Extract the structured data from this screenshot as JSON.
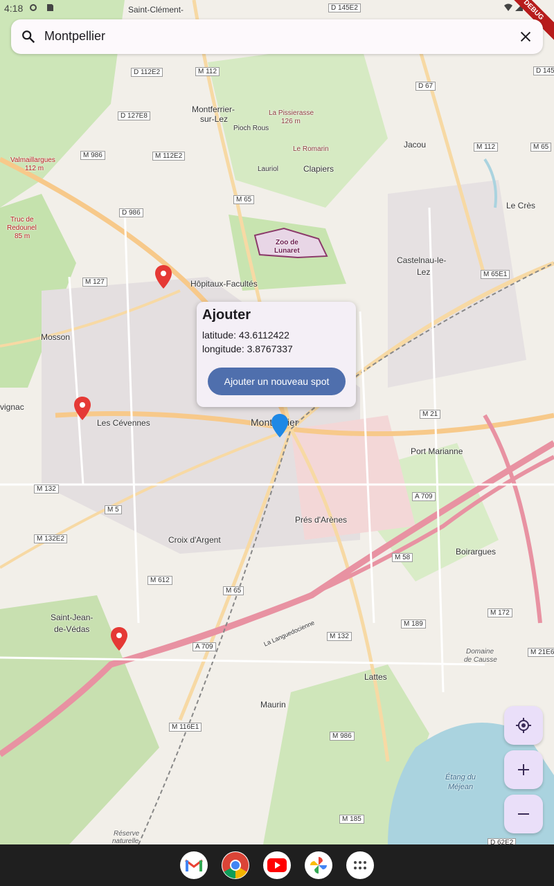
{
  "status": {
    "time": "4:18",
    "debug_label": "DEBUG"
  },
  "search": {
    "query": "Montpellier"
  },
  "popup": {
    "title": "Ajouter",
    "latitude": "latitude: 43.6112422",
    "longitude": "longitude: 3.8767337",
    "button": "Ajouter un nouveau spot"
  },
  "map": {
    "labels": {
      "saint_clement": "Saint-Clément-",
      "montferrier": "Montferrier-",
      "sur_lez": "sur-Lez",
      "pioch_rous": "Pioch Rous",
      "la_pissierasse": "La Pissierasse",
      "elev_126": "126 m",
      "le_romarin": "Le Romarin",
      "jacou": "Jacou",
      "lauriol": "Lauriol",
      "clapiers": "Clapiers",
      "valmaillargues": "Valmaillargues",
      "elev_112": "112 m",
      "truc_de": "Truc de",
      "redounel": "Redounel",
      "elev_85": "85 m",
      "zoo": "Zoo de",
      "lunaret": "Lunaret",
      "le_cres": "Le Crès",
      "castelnau": "Castelnau-le-",
      "lez": "Lez",
      "hopitaux": "Hôpitaux-Facultés",
      "mosson": "Mosson",
      "vignac": "vignac",
      "les_cevennes": "Les Cévennes",
      "montpellier": "Montpellier",
      "port_marianne": "Port Marianne",
      "pres_darenes": "Prés d'Arènes",
      "croix_dargent": "Croix d'Argent",
      "boirargues": "Boirargues",
      "saint_jean": "Saint-Jean-",
      "de_vedas": "de-Védas",
      "la_languedocienne": "La Languedocienne",
      "lattes": "Lattes",
      "domaine": "Domaine",
      "de_causse": "de Causse",
      "maurin": "Maurin",
      "etang": "Étang du",
      "mejean": "Méjean",
      "reserve": "Réserve",
      "naturelle": "naturelle"
    },
    "roads": {
      "d145e2": "D 145E2",
      "d112e2": "D 112E2",
      "m112": "M 112",
      "d145": "D 145",
      "d67": "D 67",
      "d127e8": "D 127E8",
      "m986": "M 986",
      "m112e2": "M 112E2",
      "m112b": "M 112",
      "m65b": "M 65",
      "m65": "M 65",
      "d986": "D 986",
      "m127": "M 127",
      "m65e1": "M 65E1",
      "m21": "M 21",
      "m132": "M 132",
      "a709": "A 709",
      "m5": "M 5",
      "m132e2": "M 132E2",
      "m58": "M 58",
      "m612": "M 612",
      "m65c": "M 65",
      "m172": "M 172",
      "m189": "M 189",
      "m132b": "M 132",
      "a709b": "A 709",
      "m21e6": "M 21E6",
      "m986b": "M 986",
      "m116e1": "M 116E1",
      "m185": "M 185",
      "d62e2": "D 62E2"
    }
  },
  "colors": {
    "map_bg": "#f2efe9",
    "motorway": "#e892a2",
    "primary_road": "#fcd6a4",
    "water": "#aad3df",
    "forest": "#add19e",
    "marker_red": "#e53935",
    "marker_blue": "#1e88e5",
    "button": "#4f6fad"
  },
  "icons": [
    "search-icon",
    "close-icon",
    "my-location-icon",
    "plus-icon",
    "minus-icon",
    "gmail-icon",
    "chrome-icon",
    "youtube-icon",
    "photos-icon",
    "app-drawer-icon"
  ]
}
